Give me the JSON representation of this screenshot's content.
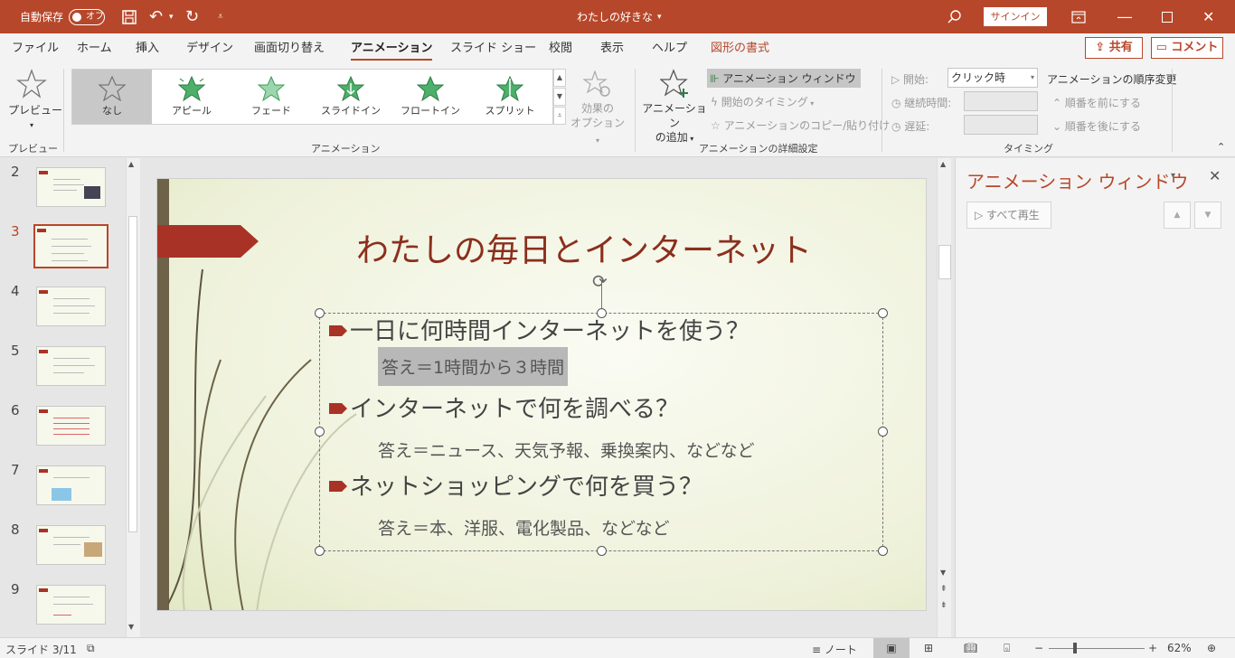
{
  "titlebar": {
    "autosave_label": "自動保存",
    "autosave_state": "オフ",
    "doc_title": "わたしの好きな",
    "signin": "サインイン"
  },
  "tabs": [
    "ファイル",
    "ホーム",
    "挿入",
    "デザイン",
    "画面切り替え",
    "アニメーション",
    "スライド ショー",
    "校閲",
    "表示",
    "ヘルプ",
    "図形の書式"
  ],
  "share": {
    "share_label": "共有",
    "comment_label": "コメント"
  },
  "ribbon": {
    "preview": {
      "button": "プレビュー",
      "group": "プレビュー"
    },
    "animation_gallery": {
      "items": [
        "なし",
        "アピール",
        "フェード",
        "スライドイン",
        "フロートイン",
        "スプリット"
      ],
      "selected": "なし",
      "effect_options": "効果の\nオプション",
      "group": "アニメーション"
    },
    "advanced": {
      "add_animation": "アニメーション\nの追加",
      "anim_pane": "アニメーション ウィンドウ",
      "trigger": "開始のタイミング",
      "painter": "アニメーションのコピー/貼り付け",
      "group": "アニメーションの詳細設定"
    },
    "timing": {
      "start_label": "開始:",
      "start_value": "クリック時",
      "duration_label": "継続時間:",
      "delay_label": "遅延:",
      "reorder_title": "アニメーションの順序変更",
      "move_earlier": "順番を前にする",
      "move_later": "順番を後にする",
      "group": "タイミング"
    }
  },
  "thumbnails": [
    "2",
    "3",
    "4",
    "5",
    "6",
    "7",
    "8",
    "9"
  ],
  "current_slide": "3",
  "slide": {
    "title": "わたしの毎日とインターネット",
    "bullets": [
      {
        "q": "一日に何時間インターネットを使う？",
        "a": "答え＝1時間から３時間"
      },
      {
        "q": "インターネットで何を調べる？",
        "a": "答え＝ニュース、天気予報、乗換案内、などなど"
      },
      {
        "q": "ネットショッピングで何を買う？",
        "a": "答え＝本、洋服、電化製品、などなど"
      }
    ]
  },
  "anim_pane": {
    "title": "アニメーション ウィンドウ",
    "play_all": "すべて再生"
  },
  "status": {
    "slide_info": "スライド 3/11",
    "notes": "ノート",
    "zoom": "62%"
  },
  "colors": {
    "accent": "#b7472a",
    "slide_bar": "#6e6248",
    "title_text": "#8b2f1d"
  }
}
